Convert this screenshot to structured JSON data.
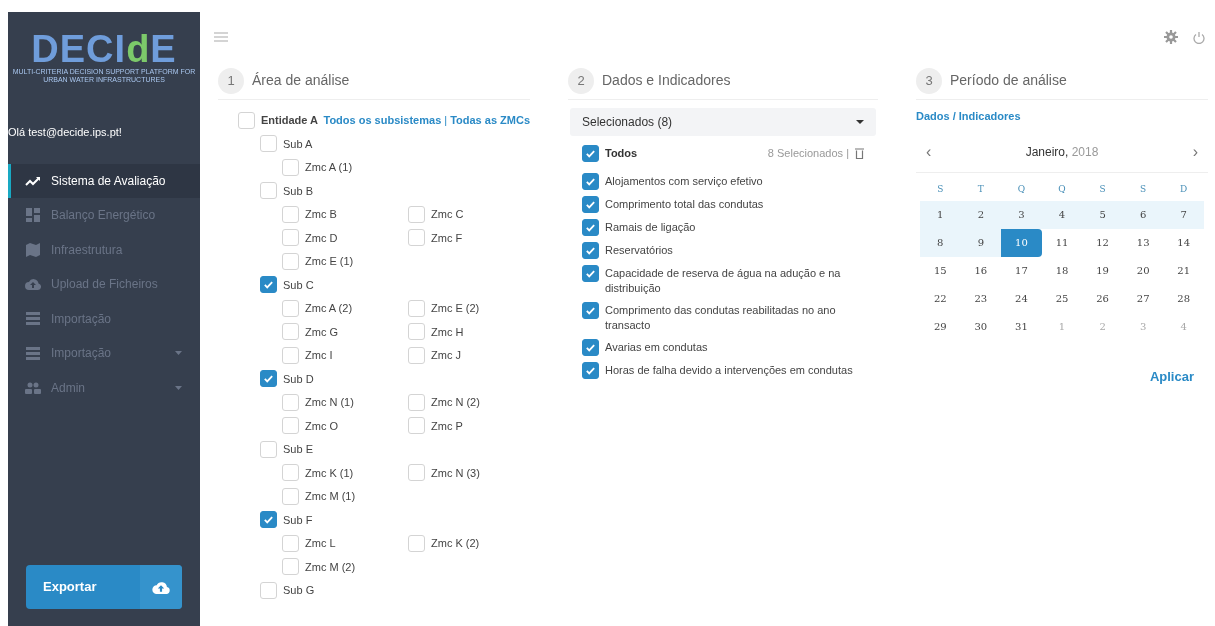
{
  "sidebar": {
    "logo": {
      "title": "DECIdE",
      "subtitle": "MULTI-CRITERIA DECISION SUPPORT PLATFORM FOR URBAN WATER INFRASTRUCTURES"
    },
    "greeting": "Olá test@decide.ips.pt!",
    "items": [
      {
        "label": "Sistema de Avaliação",
        "kind": "chart",
        "selected": true,
        "disabled": false,
        "expandable": false
      },
      {
        "label": "Balanço Energético",
        "kind": "dashboard",
        "selected": false,
        "disabled": true,
        "expandable": false
      },
      {
        "label": "Infraestrutura",
        "kind": "map",
        "selected": false,
        "disabled": true,
        "expandable": false
      },
      {
        "label": "Upload de Ficheiros",
        "kind": "upload",
        "selected": false,
        "disabled": true,
        "expandable": false
      },
      {
        "label": "Importação",
        "kind": "list",
        "selected": false,
        "disabled": true,
        "expandable": false
      },
      {
        "label": "Importação",
        "kind": "list",
        "selected": false,
        "disabled": true,
        "expandable": true
      },
      {
        "label": "Admin",
        "kind": "users",
        "selected": false,
        "disabled": true,
        "expandable": true
      }
    ],
    "export_button": "Exportar"
  },
  "area": {
    "step": "1",
    "title": "Área de análise",
    "entity": {
      "label": "Entidade A",
      "checked": false
    },
    "links": [
      "Todos os subsistemas",
      "Todas as ZMCs"
    ],
    "link_separator": "|",
    "subsystems": [
      {
        "label": "Sub A",
        "checked": false,
        "children": [
          {
            "label": "Zmc A (1)",
            "checked": false
          }
        ]
      },
      {
        "label": "Sub B",
        "checked": false,
        "children": [
          {
            "label": "Zmc B",
            "checked": false
          },
          {
            "label": "Zmc C",
            "checked": false
          },
          {
            "label": "Zmc D",
            "checked": false
          },
          {
            "label": "Zmc F",
            "checked": false
          },
          {
            "label": "Zmc E (1)",
            "checked": false
          }
        ]
      },
      {
        "label": "Sub C",
        "checked": true,
        "children": [
          {
            "label": "Zmc A (2)",
            "checked": false
          },
          {
            "label": "Zmc E (2)",
            "checked": false
          },
          {
            "label": "Zmc G",
            "checked": false
          },
          {
            "label": "Zmc H",
            "checked": false
          },
          {
            "label": "Zmc I",
            "checked": false
          },
          {
            "label": "Zmc J",
            "checked": false
          }
        ]
      },
      {
        "label": "Sub D",
        "checked": true,
        "children": [
          {
            "label": "Zmc N (1)",
            "checked": false
          },
          {
            "label": "Zmc N (2)",
            "checked": false
          },
          {
            "label": "Zmc O",
            "checked": false
          },
          {
            "label": "Zmc P",
            "checked": false
          }
        ]
      },
      {
        "label": "Sub E",
        "checked": false,
        "children": [
          {
            "label": "Zmc K (1)",
            "checked": false
          },
          {
            "label": "Zmc N (3)",
            "checked": false
          },
          {
            "label": "Zmc M (1)",
            "checked": false
          }
        ]
      },
      {
        "label": "Sub F",
        "checked": true,
        "children": [
          {
            "label": "Zmc L",
            "checked": false
          },
          {
            "label": "Zmc K (2)",
            "checked": false
          },
          {
            "label": "Zmc M (2)",
            "checked": false
          }
        ]
      },
      {
        "label": "Sub G",
        "checked": false
      }
    ]
  },
  "data": {
    "step": "2",
    "title": "Dados e Indicadores",
    "dropdown": "Selecionados (8)",
    "all": {
      "label": "Todos",
      "checked": true
    },
    "count": "8 Selecionados |",
    "indicators": [
      {
        "label": "Alojamentos com serviço efetivo",
        "checked": true
      },
      {
        "label": "Comprimento total das condutas",
        "checked": true
      },
      {
        "label": "Ramais de ligação",
        "checked": true
      },
      {
        "label": "Reservatórios",
        "checked": true
      },
      {
        "label": "Capacidade de reserva de água na adução e na distribuição",
        "checked": true
      },
      {
        "label": "Comprimento das condutas reabilitadas no ano transacto",
        "checked": true
      },
      {
        "label": "Avarias em condutas",
        "checked": true
      },
      {
        "label": "Horas de falha devido a intervenções em condutas",
        "checked": true
      }
    ]
  },
  "period": {
    "step": "3",
    "title": "Período de análise",
    "link": "Dados / Indicadores",
    "month": "Janeiro,",
    "year": "2018",
    "prev": "‹",
    "next": "›",
    "weekdays": [
      "S",
      "T",
      "Q",
      "Q",
      "S",
      "S",
      "D"
    ],
    "weeks": [
      [
        {
          "day": "1",
          "kind": "range"
        },
        {
          "day": "2",
          "kind": "range"
        },
        {
          "day": "3",
          "kind": "range"
        },
        {
          "day": "4",
          "kind": "range"
        },
        {
          "day": "5",
          "kind": "range"
        },
        {
          "day": "6",
          "kind": "range"
        },
        {
          "day": "7",
          "kind": "range"
        }
      ],
      [
        {
          "day": "8",
          "kind": "range"
        },
        {
          "day": "9",
          "kind": "range"
        },
        {
          "day": "10",
          "kind": "selected"
        },
        {
          "day": "11",
          "kind": "normal"
        },
        {
          "day": "12",
          "kind": "normal"
        },
        {
          "day": "13",
          "kind": "normal"
        },
        {
          "day": "14",
          "kind": "normal"
        }
      ],
      [
        {
          "day": "15",
          "kind": "normal"
        },
        {
          "day": "16",
          "kind": "normal"
        },
        {
          "day": "17",
          "kind": "normal"
        },
        {
          "day": "18",
          "kind": "normal"
        },
        {
          "day": "19",
          "kind": "normal"
        },
        {
          "day": "20",
          "kind": "normal"
        },
        {
          "day": "21",
          "kind": "normal"
        }
      ],
      [
        {
          "day": "22",
          "kind": "normal"
        },
        {
          "day": "23",
          "kind": "normal"
        },
        {
          "day": "24",
          "kind": "normal"
        },
        {
          "day": "25",
          "kind": "normal"
        },
        {
          "day": "26",
          "kind": "normal"
        },
        {
          "day": "27",
          "kind": "normal"
        },
        {
          "day": "28",
          "kind": "normal"
        }
      ],
      [
        {
          "day": "29",
          "kind": "normal"
        },
        {
          "day": "30",
          "kind": "normal"
        },
        {
          "day": "31",
          "kind": "normal"
        },
        {
          "day": "1",
          "kind": "outside"
        },
        {
          "day": "2",
          "kind": "outside"
        },
        {
          "day": "3",
          "kind": "outside"
        },
        {
          "day": "4",
          "kind": "outside"
        }
      ]
    ],
    "apply": "Aplicar"
  }
}
